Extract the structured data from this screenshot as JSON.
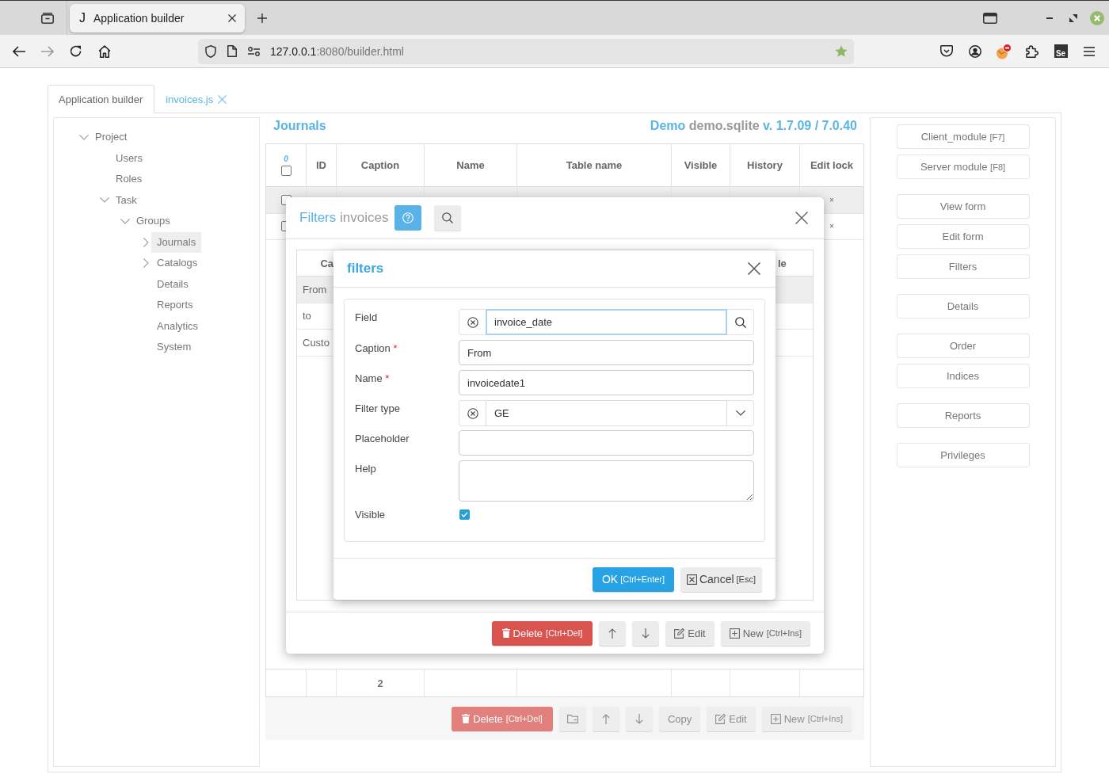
{
  "browser": {
    "tab": {
      "favicon": "J",
      "title": "Application builder"
    },
    "url": {
      "host": "127.0.0.1",
      "rest": ":8080/builder.html"
    },
    "bookmarked": true,
    "extension_label": "Se"
  },
  "app_tabs": [
    {
      "label": "Application builder",
      "selected": true,
      "closable": false
    },
    {
      "label": "invoices.js",
      "selected": false,
      "closable": true
    }
  ],
  "tree": [
    {
      "label": "Project",
      "expanded": true,
      "selected": false,
      "children": [
        {
          "label": "Users",
          "selected": false
        },
        {
          "label": "Roles",
          "selected": false
        },
        {
          "label": "Task",
          "expanded": true,
          "selected": false,
          "children": [
            {
              "label": "Groups",
              "expanded": true,
              "selected": false,
              "children": [
                {
                  "label": "Journals",
                  "expanded": false,
                  "selected": true
                },
                {
                  "label": "Catalogs",
                  "expanded": false,
                  "selected": false
                },
                {
                  "label": "Details",
                  "selected": false
                },
                {
                  "label": "Reports",
                  "selected": false
                },
                {
                  "label": "Analytics",
                  "selected": false
                },
                {
                  "label": "System",
                  "selected": false
                }
              ]
            }
          ]
        }
      ]
    }
  ],
  "journals": {
    "title": "Journals",
    "info": {
      "app": "Demo",
      "db": "demo.sqlite",
      "version": "v. 1.7.09 / 7.0.40"
    },
    "table": {
      "select_all": {
        "count": "0",
        "checked": false
      },
      "columns": [
        "ID",
        "Caption",
        "Name",
        "Table name",
        "Visible",
        "History",
        "Edit lock"
      ],
      "rows": [
        {
          "selected": true,
          "checked": false,
          "edit_lock": "×"
        },
        {
          "selected": false,
          "checked": false,
          "edit_lock": "×"
        }
      ],
      "footer": {
        "caption": "2"
      }
    },
    "toolbar": {
      "disabled": true,
      "buttons": [
        {
          "kind": "delete",
          "label": "Delete",
          "shortcut": "[Ctrl+Del]"
        },
        {
          "kind": "folder"
        },
        {
          "kind": "up"
        },
        {
          "kind": "down"
        },
        {
          "kind": "copy",
          "label": "Copy"
        },
        {
          "kind": "edit",
          "label": "Edit"
        },
        {
          "kind": "new",
          "label": "New",
          "shortcut": "[Ctrl+Ins]"
        }
      ]
    }
  },
  "side_panel": {
    "groups": [
      {
        "buttons": [
          {
            "label": "Client_module",
            "shortcut": "[F7]"
          },
          {
            "label": "Server module",
            "shortcut": "[F8]"
          }
        ]
      },
      {
        "buttons": [
          {
            "label": "View form"
          },
          {
            "label": "Edit form"
          },
          {
            "label": "Filters"
          }
        ]
      },
      {
        "buttons": [
          {
            "label": "Details"
          }
        ]
      },
      {
        "buttons": [
          {
            "label": "Order"
          },
          {
            "label": "Indices"
          }
        ]
      },
      {
        "buttons": [
          {
            "label": "Reports"
          }
        ]
      },
      {
        "buttons": [
          {
            "label": "Privileges"
          }
        ]
      }
    ]
  },
  "filters_dialog": {
    "title": {
      "accent": "Filters",
      "rest": "invoices"
    },
    "table": {
      "columns": [
        "Ca",
        "le"
      ],
      "rows": [
        {
          "caption": "From",
          "selected": true
        },
        {
          "caption": "to",
          "selected": false
        },
        {
          "caption": "Custo",
          "selected": false
        }
      ]
    },
    "toolbar": {
      "disabled": false,
      "buttons": [
        {
          "kind": "delete",
          "label": "Delete",
          "shortcut": "[Ctrl+Del]"
        },
        {
          "kind": "up"
        },
        {
          "kind": "down"
        },
        {
          "kind": "edit",
          "label": "Edit"
        },
        {
          "kind": "new",
          "label": "New",
          "shortcut": "[Ctrl+Ins]"
        }
      ]
    }
  },
  "field_dialog": {
    "title": "filters",
    "fields": [
      {
        "kind": "lookup",
        "label": "Field",
        "value": "invoice_date",
        "focused": true
      },
      {
        "kind": "text",
        "label": "Caption",
        "required_mark": "*",
        "value": "From",
        "focused": false
      },
      {
        "kind": "text",
        "label": "Name",
        "required_mark": "*",
        "value": "invoicedate1",
        "focused": false
      },
      {
        "kind": "select",
        "label": "Filter type",
        "value": "GE",
        "focused": false
      },
      {
        "kind": "text",
        "label": "Placeholder",
        "focused": false
      },
      {
        "kind": "textarea",
        "label": "Help",
        "focused": false
      },
      {
        "kind": "checkbox",
        "label": "Visible",
        "checked": true
      }
    ],
    "buttons": [
      {
        "kind": "ok",
        "label": "OK",
        "shortcut": "[Ctrl+Enter]"
      },
      {
        "kind": "cancel",
        "label": "Cancel",
        "shortcut": "[Esc]"
      }
    ]
  }
}
